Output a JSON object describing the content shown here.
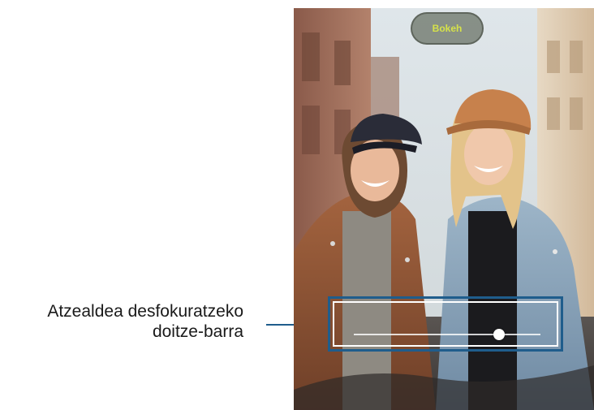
{
  "callout": {
    "line1": "Atzealdea desfokuratzeko",
    "line2": "doitze-barra"
  },
  "photo": {
    "background_button_label": "Bokeh"
  },
  "blur_slider": {
    "level_fraction": 0.78
  },
  "colors": {
    "callout_accent": "#1f5d8c",
    "button_text": "#d6e24a"
  }
}
